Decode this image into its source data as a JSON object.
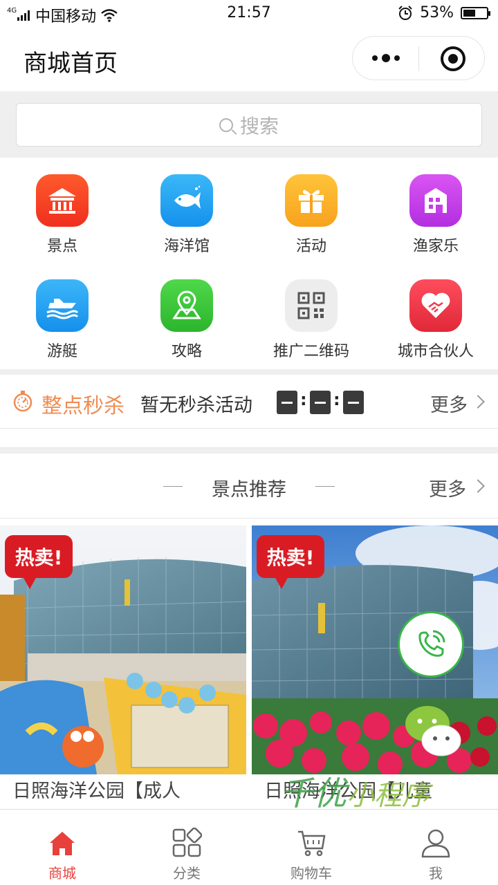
{
  "status_bar": {
    "network": "4G",
    "carrier": "中国移动",
    "time": "21:57",
    "battery": "53%",
    "battery_level": 0.53
  },
  "header": {
    "title": "商城首页"
  },
  "search": {
    "placeholder": "搜索"
  },
  "categories": [
    {
      "label": "景点",
      "icon": "temple-icon",
      "color": "#f5401f"
    },
    {
      "label": "海洋馆",
      "icon": "fish-icon",
      "color": "#1e9df0"
    },
    {
      "label": "活动",
      "icon": "gift-icon",
      "color": "#fbb12a"
    },
    {
      "label": "渔家乐",
      "icon": "house-icon",
      "color": "#c63ee8"
    },
    {
      "label": "游艇",
      "icon": "yacht-icon",
      "color": "#2aa2f0"
    },
    {
      "label": "攻略",
      "icon": "map-pin-icon",
      "color": "#3cc83c"
    },
    {
      "label": "推广二维码",
      "icon": "qr-code-icon",
      "color": "#eeeeee"
    },
    {
      "label": "城市合伙人",
      "icon": "handshake-heart-icon",
      "color": "#ee3a4c"
    }
  ],
  "flash_sale": {
    "title": "整点秒杀",
    "message": "暂无秒杀活动",
    "more": "更多",
    "accent": "#f08b52"
  },
  "recommend": {
    "title": "景点推荐",
    "more": "更多"
  },
  "products": [
    {
      "badge": "热卖!",
      "title": "日照海洋公园【成人"
    },
    {
      "badge": "热卖!",
      "title": "日照海洋公园【儿童"
    }
  ],
  "watermark": {
    "text": "千优",
    "sub": "小程序"
  },
  "tabbar": [
    {
      "label": "商城",
      "icon": "home-icon",
      "active": true
    },
    {
      "label": "分类",
      "icon": "category-icon",
      "active": false
    },
    {
      "label": "购物车",
      "icon": "cart-icon",
      "active": false
    },
    {
      "label": "我",
      "icon": "user-icon",
      "active": false
    }
  ],
  "colors": {
    "accent_red": "#e8403a",
    "flash_orange": "#f08b52",
    "wechat_green": "#3bb54a"
  }
}
